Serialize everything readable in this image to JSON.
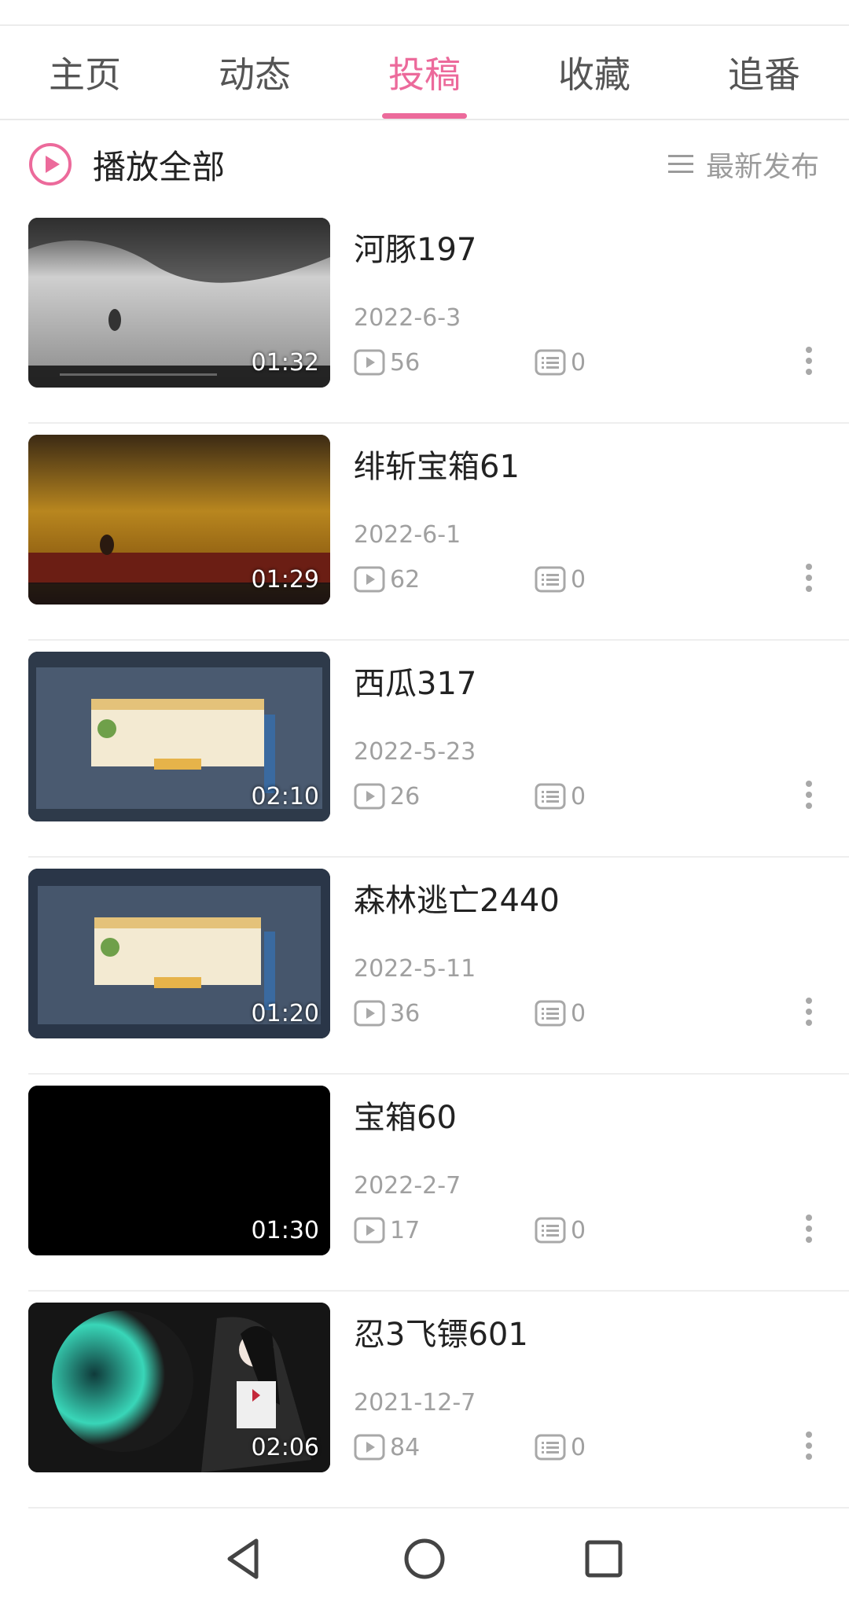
{
  "tabs": [
    {
      "label": "主页",
      "active": false
    },
    {
      "label": "动态",
      "active": false
    },
    {
      "label": "投稿",
      "active": true
    },
    {
      "label": "收藏",
      "active": false
    },
    {
      "label": "追番",
      "active": false
    }
  ],
  "play_all": {
    "label": "播放全部",
    "icon": "play-circle-icon"
  },
  "sort": {
    "label": "最新发布",
    "icon": "list-sort-icon"
  },
  "videos": [
    {
      "title": "河豚197",
      "date": "2022-6-3",
      "duration": "01:32",
      "plays": "56",
      "comments": "0"
    },
    {
      "title": "绯斩宝箱61",
      "date": "2022-6-1",
      "duration": "01:29",
      "plays": "62",
      "comments": "0"
    },
    {
      "title": "西瓜317",
      "date": "2022-5-23",
      "duration": "02:10",
      "plays": "26",
      "comments": "0"
    },
    {
      "title": "森林逃亡2440",
      "date": "2022-5-11",
      "duration": "01:20",
      "plays": "36",
      "comments": "0"
    },
    {
      "title": "宝箱60",
      "date": "2022-2-7",
      "duration": "01:30",
      "plays": "17",
      "comments": "0"
    },
    {
      "title": "忍3飞镖601",
      "date": "2021-12-7",
      "duration": "02:06",
      "plays": "84",
      "comments": "0"
    }
  ],
  "navbar": {
    "back": "back-triangle-icon",
    "home": "home-circle-icon",
    "recents": "recents-square-icon"
  },
  "colors": {
    "accent": "#ec6a9b",
    "muted": "#a0a0a0",
    "text": "#222222"
  }
}
